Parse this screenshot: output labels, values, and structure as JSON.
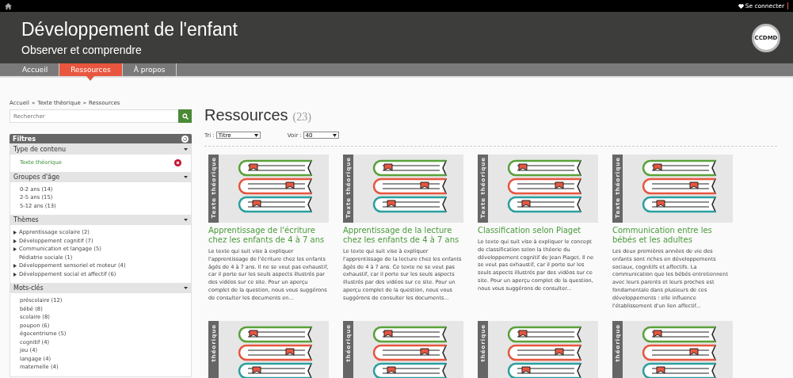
{
  "topbar": {
    "login": "Se connecter"
  },
  "header": {
    "title": "Développement de l'enfant",
    "subtitle": "Observer et comprendre",
    "logo": "CCDMD"
  },
  "nav": [
    {
      "label": "Accueil",
      "selected": false
    },
    {
      "label": "Ressources",
      "selected": true
    },
    {
      "label": "À propos",
      "selected": false
    }
  ],
  "sidebar": {
    "breadcrumb": [
      "Accueil",
      "Texte théorique",
      "Ressources"
    ],
    "breadcrumb_sep": "»",
    "search": {
      "placeholder": "Rechercher"
    },
    "filters_title": "Filtres",
    "sections": [
      {
        "title": "Type de contenu",
        "kind": "active",
        "items": [
          {
            "label": "Texte théorique"
          }
        ]
      },
      {
        "title": "Groupes d'âge",
        "kind": "plain",
        "items": [
          {
            "label": "0-2 ans (14)"
          },
          {
            "label": "2-5 ans (15)"
          },
          {
            "label": "5-12 ans (13)"
          }
        ]
      },
      {
        "title": "Thèmes",
        "kind": "tree",
        "items": [
          {
            "label": "Apprentissage scolaire (2)",
            "expandable": true
          },
          {
            "label": "Développement cognitif (7)",
            "expandable": true
          },
          {
            "label": "Communication et langage (5)",
            "expandable": true
          },
          {
            "label": "Pédiatrie sociale (1)",
            "expandable": false
          },
          {
            "label": "Développement sensoriel et moteur (4)",
            "expandable": true
          },
          {
            "label": "Développement social et affectif (6)",
            "expandable": true
          }
        ]
      },
      {
        "title": "Mots-clés",
        "kind": "plain",
        "items": [
          {
            "label": "préscolaire (12)"
          },
          {
            "label": "bébé (8)"
          },
          {
            "label": "scolaire (8)"
          },
          {
            "label": "poupon (6)"
          },
          {
            "label": "égocentrisme (5)"
          },
          {
            "label": "cognitif (4)"
          },
          {
            "label": "jeu (4)"
          },
          {
            "label": "langage (4)"
          },
          {
            "label": "maternelle (4)"
          }
        ]
      }
    ]
  },
  "main": {
    "title": "Ressources",
    "count": "(23)",
    "sort": {
      "label": "Tri :",
      "value": "Titre"
    },
    "view": {
      "label": "Voir :",
      "value": "40"
    },
    "cards": [
      {
        "tag": "Texte théorique",
        "title": "Apprentissage de l'écriture chez les enfants de 4 à 7 ans",
        "description": "Le texte qui suit vise à expliquer l'apprentissage de l'écriture chez les enfants âgés de 4 à 7 ans. Il ne se veut pas exhaustif, car il porte sur les seuls aspects illustrés par des vidéos sur ce site. Pour un aperçu complet de la question, nous vous suggérons de consulter les documents en..."
      },
      {
        "tag": "Texte théorique",
        "title": "Apprentissage de la lecture chez les enfants de 4 à 7 ans",
        "description": "Le texte qui suit vise à expliquer l'apprentissage de la lecture chez les enfants âgés de 4 à 7 ans. Ce texte ne se veut pas exhaustif, car il porte sur les seuls aspects illustrés par des vidéos sur ce site. Pour un aperçu complet de la question, nous vous suggérons de consulter les documents..."
      },
      {
        "tag": "Texte théorique",
        "title": "Classification selon Piaget",
        "description": "Le texte qui suit vise à expliquer le concept de classification selon la théorie du développement cognitif de Jean Piaget. Il ne se veut pas exhaustif, car il porte sur les seuls aspects illustrés par des vidéos sur ce site. Pour un aperçu complet de la question, nous vous suggérons de consulter..."
      },
      {
        "tag": "Texte théorique",
        "title": "Communication entre les bébés et les adultes",
        "description": "Les deux premières années de vie des enfants sont riches en développements sociaux, cognitifs et affectifs. La communication que les bébés entretiennent avec leurs parents et leurs proches est fondamentale dans plusieurs de ces développements : elle influence l'établissement d'un lien affectif..."
      },
      {
        "tag": "théorique"
      },
      {
        "tag": "théorique"
      },
      {
        "tag": "théorique"
      },
      {
        "tag": "théorique"
      }
    ]
  }
}
